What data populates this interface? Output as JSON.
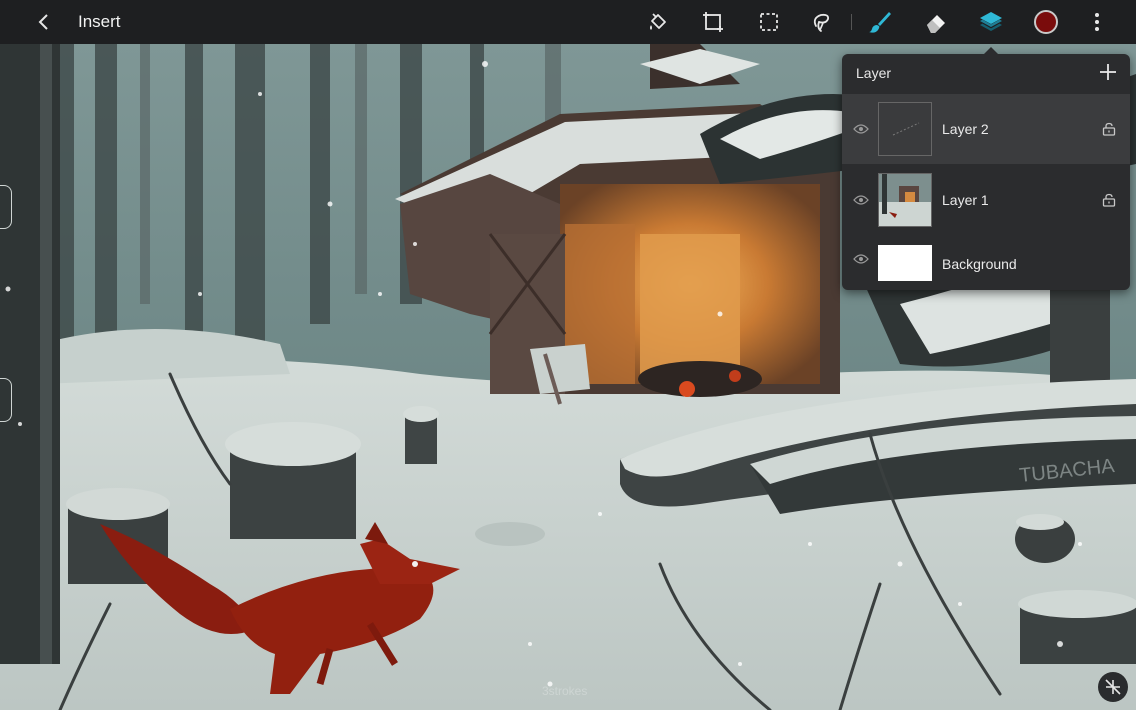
{
  "toolbar": {
    "title": "Insert",
    "tools": [
      {
        "name": "fill-bucket-icon"
      },
      {
        "name": "transform-icon"
      },
      {
        "name": "selection-icon"
      },
      {
        "name": "lasso-icon"
      },
      {
        "name": "brush-icon",
        "active": true
      },
      {
        "name": "eraser-icon"
      },
      {
        "name": "layers-icon",
        "active": true
      },
      {
        "name": "more-icon"
      }
    ],
    "current_color": "#7a0c0c",
    "accent_color": "#2fb8d6"
  },
  "layer_panel": {
    "title": "Layer",
    "layers": [
      {
        "name": "Layer 2",
        "selected": true
      },
      {
        "name": "Layer 1",
        "selected": false
      },
      {
        "name": "Background",
        "selected": false
      }
    ]
  },
  "canvas": {
    "watermark": "3strokes",
    "signature": "TUBACHA"
  }
}
